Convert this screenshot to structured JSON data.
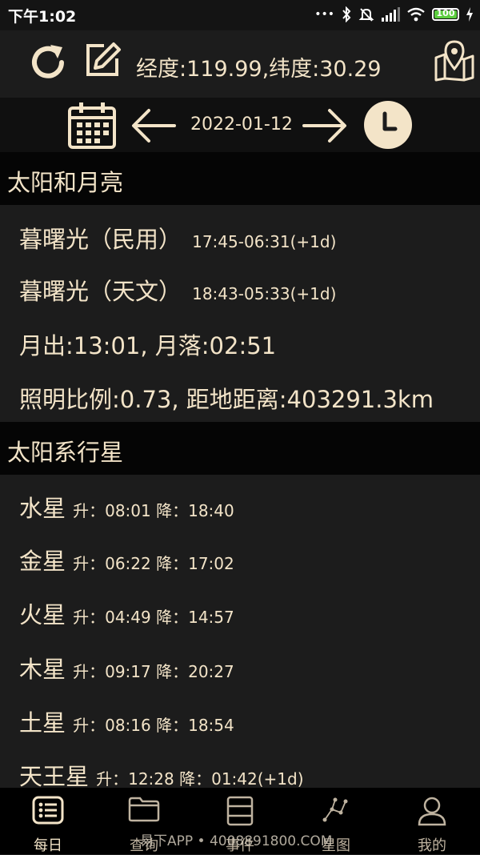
{
  "status_bar": {
    "time": "下午1:02",
    "signal_dots": "•••",
    "battery": "100"
  },
  "header": {
    "coordinates": "经度:119.99,纬度:30.29"
  },
  "date_nav": {
    "date": "2022-01-12"
  },
  "sun_moon": {
    "title": "太阳和月亮",
    "civil_twilight_label": "暮曙光（民用）",
    "civil_twilight_value": "17:45-06:31(+1d)",
    "astro_twilight_label": "暮曙光（天文）",
    "astro_twilight_value": "18:43-05:33(+1d)",
    "moon_rise_set": "月出:13:01, 月落:02:51",
    "illumination_distance": "照明比例:0.73, 距地距离:403291.3km"
  },
  "planets": {
    "title": "太阳系行星",
    "items": [
      {
        "name": "水星",
        "times": "升：08:01 降：18:40"
      },
      {
        "name": "金星",
        "times": "升：06:22 降：17:02"
      },
      {
        "name": "火星",
        "times": "升：04:49 降：14:57"
      },
      {
        "name": "木星",
        "times": "升：09:17 降：20:27"
      },
      {
        "name": "土星",
        "times": "升：08:16 降：18:54"
      },
      {
        "name": "天王星",
        "times": "升：12:28 降：01:42(+1d)"
      }
    ]
  },
  "bottom_nav": {
    "items": [
      {
        "label": "每日",
        "icon": "list-icon",
        "active": true
      },
      {
        "label": "查询",
        "icon": "folder-icon",
        "active": false
      },
      {
        "label": "事件",
        "icon": "server-icon",
        "active": false
      },
      {
        "label": "星图",
        "icon": "constellation-icon",
        "active": false
      },
      {
        "label": "我的",
        "icon": "user-icon",
        "active": false
      }
    ]
  },
  "watermark": "易下APP • 4008891800.COM",
  "colors": {
    "accent": "#f3e4c8",
    "background": "#1c1c1c",
    "section_header": "#050505",
    "nav_background": "#000000"
  }
}
